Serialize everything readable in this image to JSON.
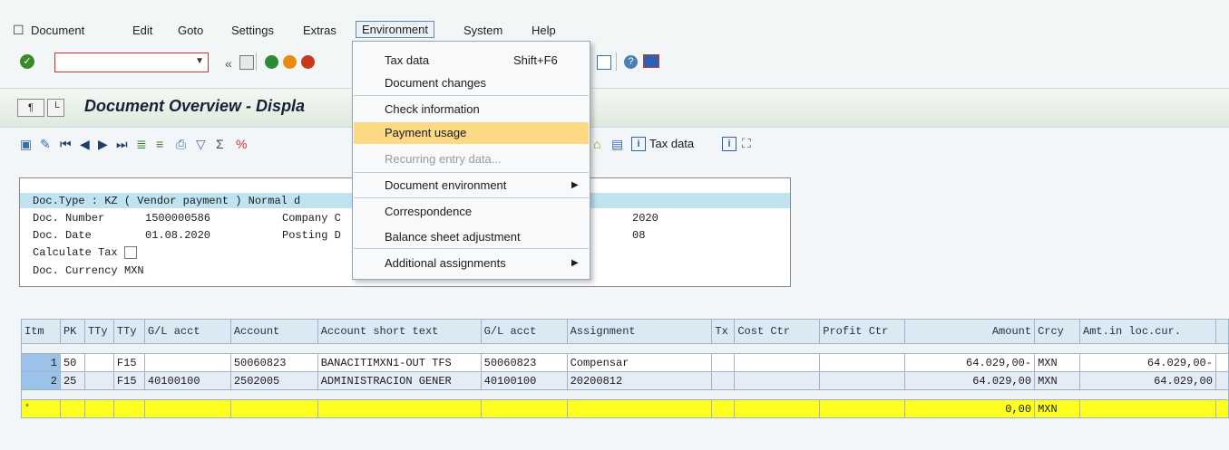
{
  "menubar": {
    "items": [
      "Document",
      "Edit",
      "Goto",
      "Settings",
      "Extras",
      "Environment",
      "System",
      "Help"
    ]
  },
  "toolbar": {
    "command_value": ""
  },
  "title": "Document Overview - Displa",
  "app_toolbar": {
    "tax_data_label": "Tax data"
  },
  "header": {
    "doc_type_line": "Doc.Type : KZ ( Vendor payment ) Normal d",
    "doc_number_label": "Doc. Number",
    "doc_number": "1500000586",
    "company_label": "Company C",
    "fiscal_year": "2020",
    "doc_date_label": "Doc. Date",
    "doc_date": "01.08.2020",
    "posting_label": "Posting D",
    "period": "08",
    "calc_tax_label": "Calculate Tax",
    "currency_label": "Doc. Currency",
    "currency": "MXN"
  },
  "table": {
    "columns": [
      "Itm",
      "PK",
      "TTy",
      "TTy",
      "G/L acct",
      "Account",
      "Account short text",
      "G/L acct",
      "Assignment",
      "Tx",
      "Cost Ctr",
      "Profit Ctr",
      "Amount",
      "Crcy",
      "Amt.in loc.cur."
    ],
    "rows": [
      {
        "itm": "1",
        "pk": "50",
        "tty1": "",
        "tty2": "F15",
        "gl": "",
        "account": "50060823",
        "short": "BANACITIMXN1-OUT TFS",
        "gl2": "50060823",
        "assign": "Compensar",
        "tx": "",
        "cc": "",
        "pc": "",
        "amount": "64.029,00-",
        "crcy": "MXN",
        "loc": "64.029,00-"
      },
      {
        "itm": "2",
        "pk": "25",
        "tty1": "",
        "tty2": "F15",
        "gl": "40100100",
        "account": "2502005",
        "short": "ADMINISTRACION GENER",
        "gl2": "40100100",
        "assign": "20200812",
        "tx": "",
        "cc": "",
        "pc": "",
        "amount": "64.029,00",
        "crcy": "MXN",
        "loc": "64.029,00"
      }
    ],
    "sum": {
      "marker": "*",
      "amount": "0,00",
      "crcy": "MXN"
    }
  },
  "dropdown": {
    "tax_data": "Tax data",
    "tax_data_shortcut": "Shift+F6",
    "doc_changes": "Document changes",
    "check_info": "Check information",
    "payment_usage": "Payment usage",
    "recurring": "Recurring entry data...",
    "doc_env": "Document environment",
    "correspondence": "Correspondence",
    "balance": "Balance sheet adjustment",
    "additional": "Additional assignments"
  },
  "colors": {
    "highlight": "#fbd985",
    "accent_green": "#3a8a2a",
    "title_blue": "#142434"
  }
}
